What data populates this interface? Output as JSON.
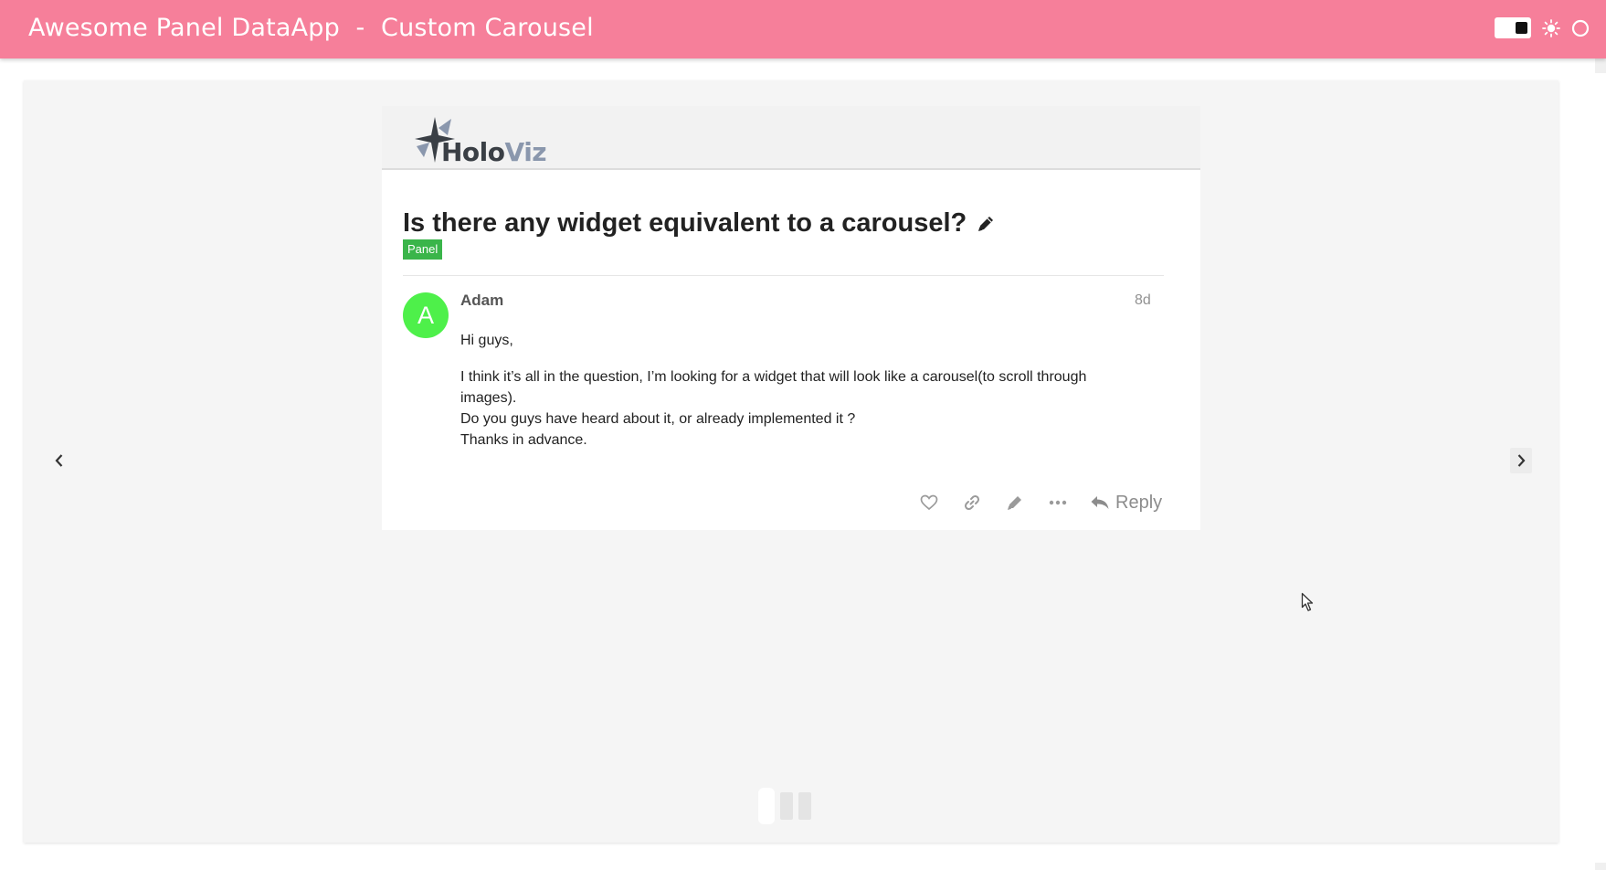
{
  "header": {
    "title": "Awesome Panel DataApp  -  Custom Carousel",
    "background_color": "#f67f9a",
    "controls": [
      "theme-toggle",
      "sun-icon",
      "circle-icon"
    ]
  },
  "carousel": {
    "prev_icon": "chevron-left-icon",
    "next_icon": "chevron-right-icon",
    "slide_count": 3,
    "active_index": 0
  },
  "slide": {
    "logo": {
      "word_main": "Holo",
      "word_accent": "Viz"
    },
    "topic_title": "Is there any widget equivalent to a carousel?",
    "edit_icon": "pencil-icon",
    "tag": "Panel",
    "tag_color": "#3ab54a",
    "post": {
      "avatar_letter": "A",
      "avatar_color": "#4ef04a",
      "author": "Adam",
      "age": "8d",
      "paragraph_1": "Hi guys,",
      "line_1": "I think it’s all in the question, I’m looking for a widget that will look like a carousel(to scroll through images).",
      "line_2": "Do you guys have heard about it, or already implemented it ?",
      "line_3": "Thanks in advance."
    },
    "actions": {
      "like_icon": "heart-icon",
      "link_icon": "link-icon",
      "edit_icon": "pencil-icon",
      "more_icon": "more-dots-icon",
      "reply_label": "Reply"
    }
  }
}
